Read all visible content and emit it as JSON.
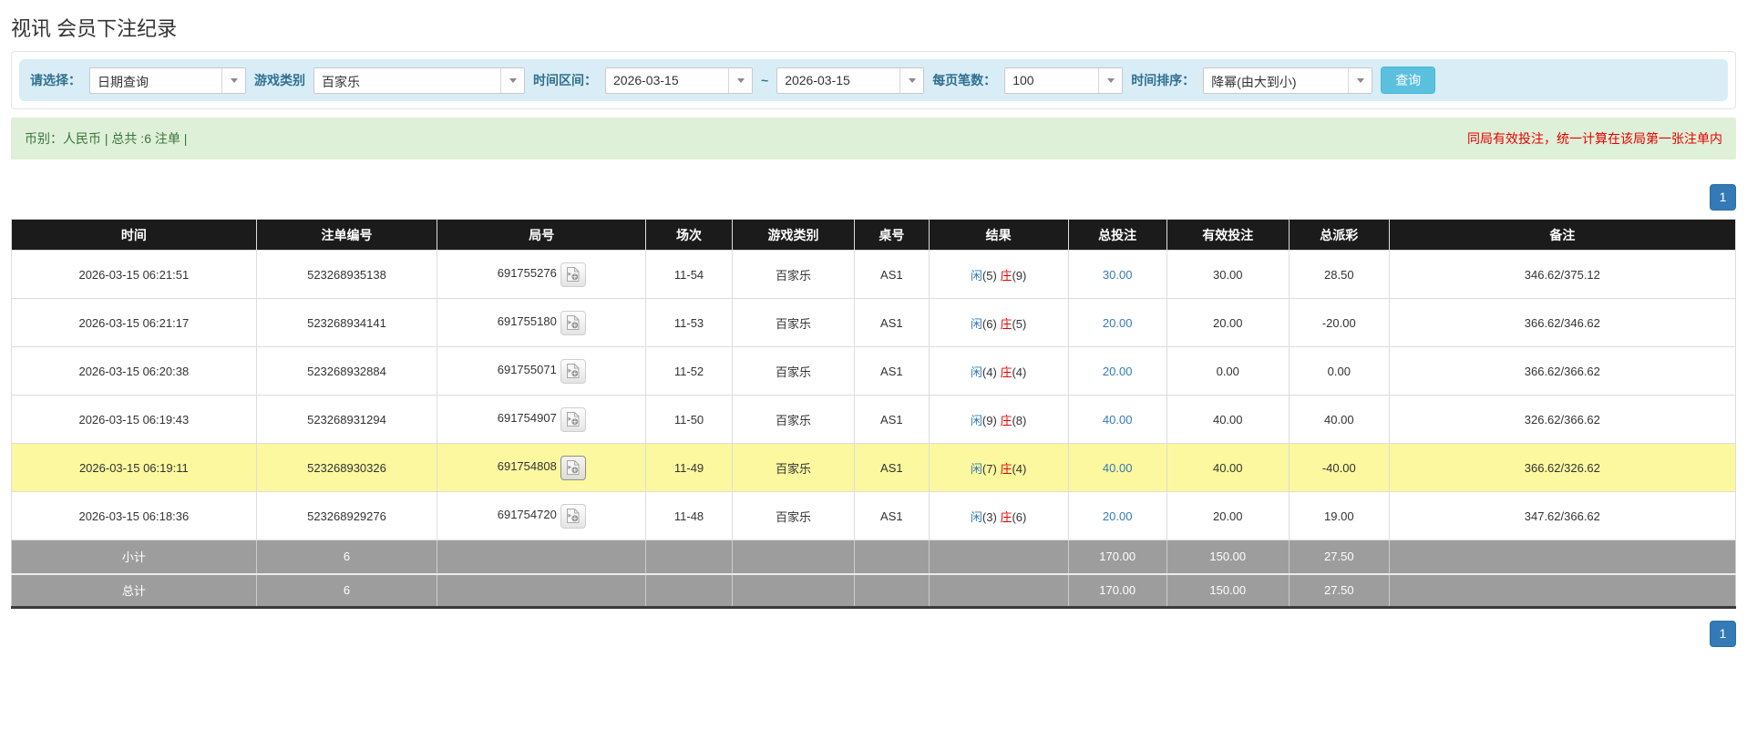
{
  "page": {
    "title": "视讯 会员下注纪录"
  },
  "filters": {
    "select_label": "请选择：",
    "select_value": "日期查询",
    "game_type_label": "游戏类别",
    "game_type_value": "百家乐",
    "time_range_label": "时间区间：",
    "date_from": "2026-03-15",
    "date_separator": "~",
    "date_to": "2026-03-15",
    "page_size_label": "每页笔数：",
    "page_size_value": "100",
    "sort_label": "时间排序：",
    "sort_value": "降幂(由大到小)",
    "search_button": "查询"
  },
  "summary_bar": {
    "left_text": "币别：人民币 | 总共 :6 注单 |",
    "right_text": "同局有效投注，统一计算在该局第一张注单内"
  },
  "pagination": {
    "page": "1"
  },
  "table": {
    "headers": [
      "时间",
      "注单编号",
      "局号",
      "场次",
      "游戏类别",
      "桌号",
      "结果",
      "总投注",
      "有效投注",
      "总派彩",
      "备注"
    ],
    "rows": [
      {
        "time": "2026-03-15 06:21:51",
        "bet_id": "523268935138",
        "round_id": "691755276",
        "session": "11-54",
        "game_type": "百家乐",
        "table_no": "AS1",
        "result": {
          "player_label": "闲",
          "player_value": "(5)",
          "banker_label": "庄",
          "banker_value": "(9)"
        },
        "total_bet": "30.00",
        "valid_bet": "30.00",
        "payout": "28.50",
        "payout_negative": false,
        "note": "346.62/375.12",
        "highlighted": false
      },
      {
        "time": "2026-03-15 06:21:17",
        "bet_id": "523268934141",
        "round_id": "691755180",
        "session": "11-53",
        "game_type": "百家乐",
        "table_no": "AS1",
        "result": {
          "player_label": "闲",
          "player_value": "(6)",
          "banker_label": "庄",
          "banker_value": "(5)"
        },
        "total_bet": "20.00",
        "valid_bet": "20.00",
        "payout": "-20.00",
        "payout_negative": true,
        "note": "366.62/346.62",
        "highlighted": false
      },
      {
        "time": "2026-03-15 06:20:38",
        "bet_id": "523268932884",
        "round_id": "691755071",
        "session": "11-52",
        "game_type": "百家乐",
        "table_no": "AS1",
        "result": {
          "player_label": "闲",
          "player_value": "(4)",
          "banker_label": "庄",
          "banker_value": "(4)"
        },
        "total_bet": "20.00",
        "valid_bet": "0.00",
        "payout": "0.00",
        "payout_negative": false,
        "note": "366.62/366.62",
        "highlighted": false
      },
      {
        "time": "2026-03-15 06:19:43",
        "bet_id": "523268931294",
        "round_id": "691754907",
        "session": "11-50",
        "game_type": "百家乐",
        "table_no": "AS1",
        "result": {
          "player_label": "闲",
          "player_value": "(9)",
          "banker_label": "庄",
          "banker_value": "(8)"
        },
        "total_bet": "40.00",
        "valid_bet": "40.00",
        "payout": "40.00",
        "payout_negative": false,
        "note": "326.62/366.62",
        "highlighted": false
      },
      {
        "time": "2026-03-15 06:19:11",
        "bet_id": "523268930326",
        "round_id": "691754808",
        "session": "11-49",
        "game_type": "百家乐",
        "table_no": "AS1",
        "result": {
          "player_label": "闲",
          "player_value": "(7)",
          "banker_label": "庄",
          "banker_value": "(4)"
        },
        "total_bet": "40.00",
        "valid_bet": "40.00",
        "payout": "-40.00",
        "payout_negative": true,
        "note": "366.62/326.62",
        "highlighted": true
      },
      {
        "time": "2026-03-15 06:18:36",
        "bet_id": "523268929276",
        "round_id": "691754720",
        "session": "11-48",
        "game_type": "百家乐",
        "table_no": "AS1",
        "result": {
          "player_label": "闲",
          "player_value": "(3)",
          "banker_label": "庄",
          "banker_value": "(6)"
        },
        "total_bet": "20.00",
        "valid_bet": "20.00",
        "payout": "19.00",
        "payout_negative": false,
        "note": "347.62/366.62",
        "highlighted": false
      }
    ],
    "subtotal": {
      "label": "小计",
      "count": "6",
      "total_bet": "170.00",
      "valid_bet": "150.00",
      "payout": "27.50"
    },
    "total": {
      "label": "总计",
      "count": "6",
      "total_bet": "170.00",
      "valid_bet": "150.00",
      "payout": "27.50"
    }
  },
  "colors": {
    "accent_blue": "#337ab7",
    "info_button": "#5bc0de",
    "filter_bar_bg": "#d9edf7",
    "filter_label": "#31708f",
    "notice_bg": "#dff0d8",
    "notice_text": "#3c763d",
    "alert_text": "#e60000",
    "header_bg": "#1b1b1b",
    "highlight_row": "#fbf89f",
    "summary_bg": "#9d9d9d",
    "player_blue": "#337ab7",
    "banker_red": "#e60000",
    "negative_red": "#e60000"
  }
}
